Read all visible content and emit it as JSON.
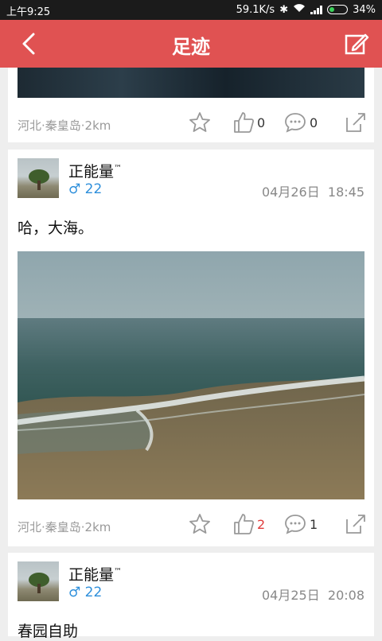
{
  "status_bar": {
    "time": "上午9:25",
    "speed": "59.1K/s",
    "battery": "34%",
    "battery_level": 0.34
  },
  "header": {
    "title": "足迹"
  },
  "posts": [
    {
      "location": "河北·秦皇岛·2km",
      "likes": "0",
      "comments": "0"
    },
    {
      "author": "正能量",
      "author_mark": "™",
      "gender_symbol": "♂",
      "age": "22",
      "date": "04月26日",
      "time": "18:45",
      "text": "哈，大海。",
      "location": "河北·秦皇岛·2km",
      "likes": "2",
      "comments": "1"
    },
    {
      "author": "正能量",
      "author_mark": "™",
      "gender_symbol": "♂",
      "age": "22",
      "date": "04月25日",
      "time": "20:08",
      "text": "春园自助"
    }
  ],
  "colors": {
    "accent": "#e05252",
    "gender": "#2e8fdb",
    "like_active": "#e03b3b"
  },
  "icons": [
    "back-arrow-icon",
    "compose-icon",
    "star-icon",
    "thumb-up-icon",
    "comment-icon",
    "share-icon",
    "male-icon"
  ]
}
